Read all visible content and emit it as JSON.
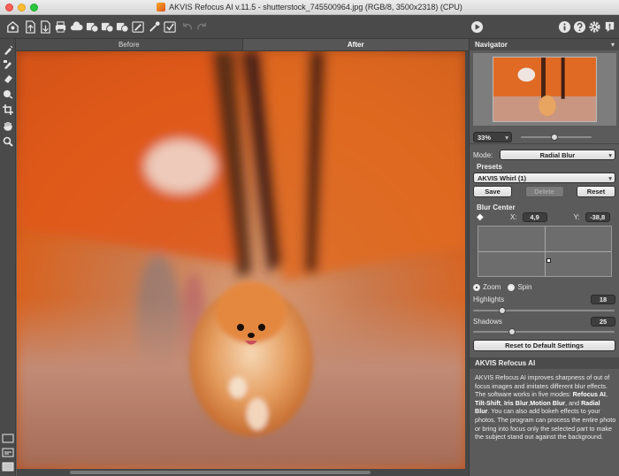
{
  "window": {
    "title": "AKVIS Refocus AI v.11.5 - shutterstock_745500964.jpg (RGB/8, 3500x2318) (CPU)"
  },
  "toolbar": {
    "left_icons": [
      "open-file-icon",
      "save-file-icon",
      "print-icon",
      "cloud-upload-icon",
      "batch-icon",
      "batch-icon-2",
      "batch-icon-3",
      "preset-brush-icon",
      "eyedropper-icon",
      "check-brush-icon",
      "undo-icon",
      "redo-icon"
    ],
    "right_icons": [
      "run-icon",
      "info-icon",
      "help-icon",
      "settings-icon",
      "notification-icon"
    ]
  },
  "tabs": {
    "before": "Before",
    "after": "After"
  },
  "colors": {
    "accent": "#f0f0f0",
    "panel": "#5b5b5b",
    "toolbar": "#4a4a4a",
    "canvas_orange": "#e06a25"
  },
  "navigator": {
    "title": "Navigator",
    "zoom": "33%"
  },
  "settings": {
    "mode_label": "Mode:",
    "mode_value": "Radial Blur",
    "presets_label": "Presets",
    "preset_value": "AKVIS Whirl (1)",
    "save_label": "Save",
    "delete_label": "Delete",
    "reset_label": "Reset",
    "blur_center_label": "Blur Center",
    "x_label": "X:",
    "x_value": "4,9",
    "y_label": "Y:",
    "y_value": "-38,8",
    "zoom_radio": "Zoom",
    "spin_radio": "Spin",
    "highlights_label": "Highlights",
    "highlights_value": "18",
    "highlights_level": 0.18,
    "shadows_label": "Shadows",
    "shadows_value": "25",
    "shadows_level": 0.25,
    "reset_defaults_label": "Reset to Default Settings"
  },
  "help": {
    "title": "AKVIS Refocus AI",
    "p1": "AKVIS Refocus AI improves sharpness of out of focus images and imitates different blur effects. The software works in five modes: ",
    "m1": "Refocus AI",
    "m2": "Tilt-Shift",
    "m3": "Iris Blur",
    "m4": "Motion Blur",
    "m5": "Radial Blur",
    "p2": "You can also add bokeh effects to your photos. The program can process the entire photo or bring into focus only the selected part to make the subject stand out against the background."
  }
}
